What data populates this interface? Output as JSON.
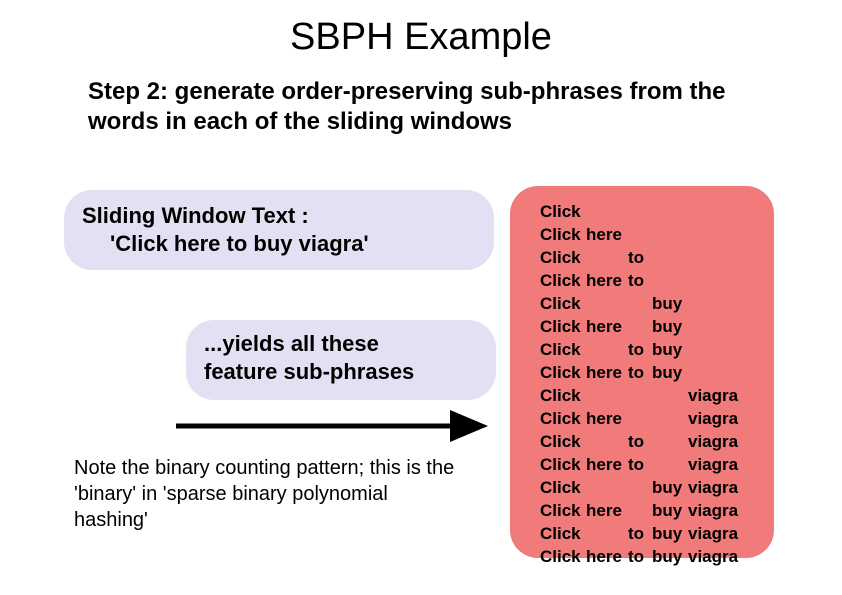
{
  "title": "SBPH Example",
  "subtitle": "Step 2: generate order-preserving sub-phrases from the words in each of the sliding windows",
  "window_box": {
    "line1": "Sliding Window Text :",
    "line2": "'Click here to buy viagra'"
  },
  "yields_box": {
    "line1": "...yields all these",
    "line2": "feature sub-phrases"
  },
  "note": "Note the binary counting pattern; this is the 'binary' in 'sparse binary polynomial hashing'",
  "phrases": [
    [
      "Click",
      "",
      "",
      "",
      ""
    ],
    [
      "Click",
      "here",
      "",
      "",
      ""
    ],
    [
      "Click",
      "",
      "to",
      "",
      ""
    ],
    [
      "Click",
      "here",
      "to",
      "",
      ""
    ],
    [
      "Click",
      "",
      "",
      "buy",
      ""
    ],
    [
      "Click",
      "here",
      "",
      "buy",
      ""
    ],
    [
      "Click",
      "",
      "to",
      "buy",
      ""
    ],
    [
      "Click",
      "here",
      "to",
      "buy",
      ""
    ],
    [
      "Click",
      "",
      "",
      "",
      "viagra"
    ],
    [
      "Click",
      "here",
      "",
      "",
      "viagra"
    ],
    [
      "Click",
      "",
      "to",
      "",
      "viagra"
    ],
    [
      "Click",
      "here",
      "to",
      "",
      "viagra"
    ],
    [
      "Click",
      "",
      "",
      "buy",
      "viagra"
    ],
    [
      "Click",
      "here",
      "",
      "buy",
      "viagra"
    ],
    [
      "Click",
      "",
      "to",
      "buy",
      "viagra"
    ],
    [
      "Click",
      "here",
      "to",
      "buy",
      "viagra"
    ]
  ]
}
